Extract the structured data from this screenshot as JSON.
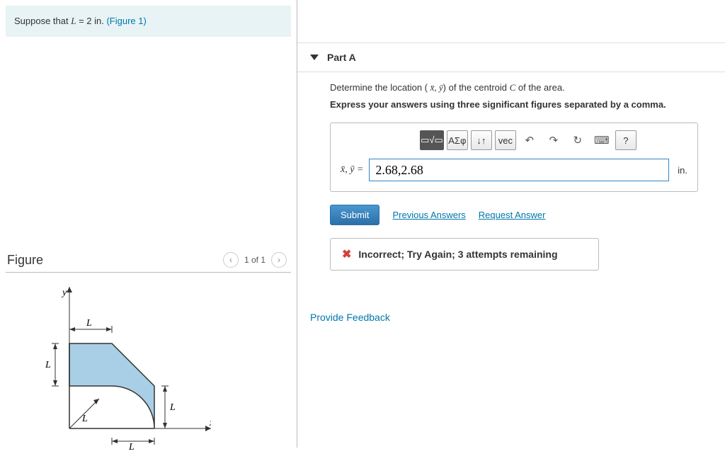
{
  "problem": {
    "prefix": "Suppose that ",
    "var": "L",
    "eq": " = 2 in. ",
    "figlink": "(Figure 1)"
  },
  "figure": {
    "title": "Figure",
    "counter": "1 of 1",
    "labels": {
      "y": "y",
      "x": "x",
      "L": "L"
    }
  },
  "part": {
    "heading": "Part A",
    "prompt_pre": "Determine the location ( ",
    "prompt_xy": "x̄, ȳ",
    "prompt_mid": ") of the centroid ",
    "prompt_C": "C",
    "prompt_post": " of the area.",
    "express": "Express your answers using three significant figures separated by a comma.",
    "toolbar": {
      "templates": "▭√▭",
      "greek": "ΑΣφ",
      "subsup": "↓↑",
      "vec": "vec",
      "undo": "↶",
      "redo": "↷",
      "reset": "↻",
      "keyboard": "⌨",
      "help": "?"
    },
    "answer_prefix": "x̄, ȳ = ",
    "answer_value": "2.68,2.68",
    "unit": "in.",
    "submit": "Submit",
    "prev_answers": "Previous Answers",
    "request_answer": "Request Answer",
    "feedback": "Incorrect; Try Again; 3 attempts remaining"
  },
  "provide_feedback": "Provide Feedback"
}
